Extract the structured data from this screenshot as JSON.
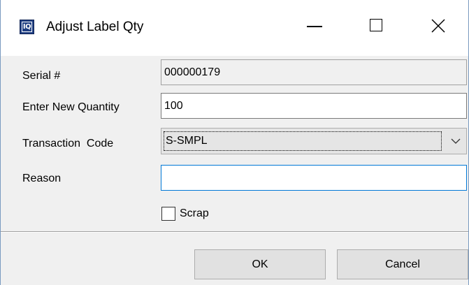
{
  "window": {
    "title": "Adjust Label Qty",
    "icon_text": "IQ"
  },
  "form": {
    "serial_label": "Serial #",
    "serial_value": "000000179",
    "quantity_label": "Enter New Quantity",
    "quantity_value": "100",
    "transaction_label": "Transaction  Code",
    "transaction_value": "S-SMPL",
    "reason_label": "Reason",
    "reason_value": "",
    "scrap_label": "Scrap",
    "scrap_checked": false
  },
  "buttons": {
    "ok_label": "OK",
    "cancel_label": "Cancel"
  },
  "icons": {
    "app": "iq-app-icon",
    "minimize": "minimize-icon",
    "maximize": "maximize-icon",
    "close": "close-icon",
    "dropdown": "chevron-down-icon"
  },
  "colors": {
    "focus_border": "#0078d7",
    "dialog_bg": "#f0f0f0",
    "app_icon_bg": "#1f3f82"
  }
}
